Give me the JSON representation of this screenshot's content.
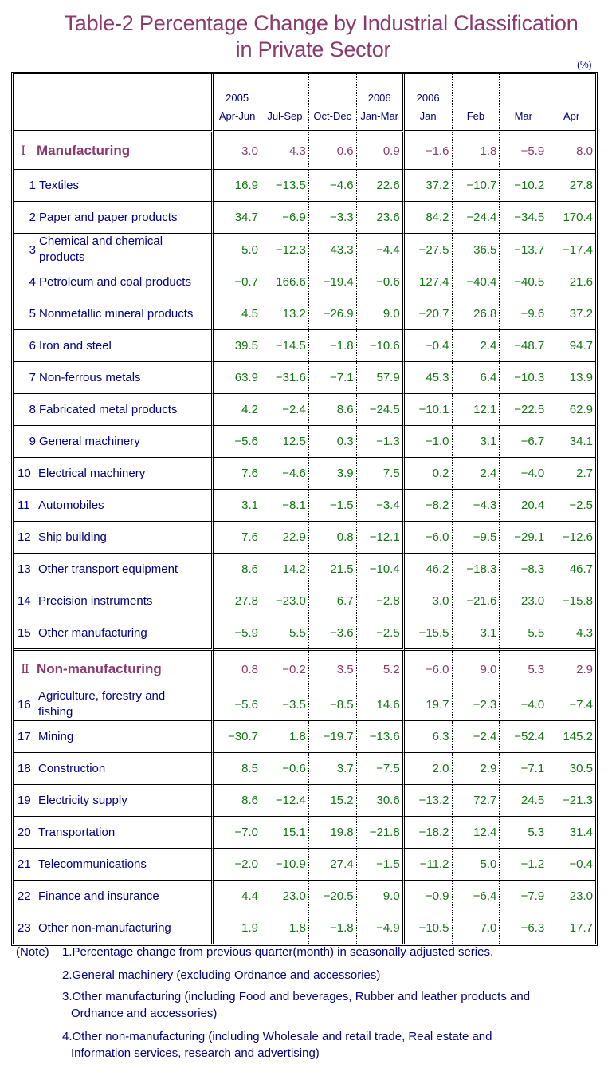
{
  "title": {
    "line1": "Table-2   Percentage Change by Industrial Classification",
    "line2": "in Private Sector"
  },
  "unit": "(%)",
  "headers": [
    {
      "year": "2005",
      "period": "Apr-Jun"
    },
    {
      "year": "",
      "period": "Jul-Sep"
    },
    {
      "year": "",
      "period": "Oct-Dec"
    },
    {
      "year": "2006",
      "period": "Jan-Mar"
    },
    {
      "year": "2006",
      "period": "Jan"
    },
    {
      "year": "",
      "period": "Feb"
    },
    {
      "year": "",
      "period": "Mar"
    },
    {
      "year": "",
      "period": "Apr"
    }
  ],
  "sections": [
    {
      "roman": "Ⅰ",
      "name": "Manufacturing",
      "values": [
        "3.0",
        "4.3",
        "0.6",
        "0.9",
        "−1.6",
        "1.8",
        "−5.9",
        "8.0"
      ],
      "items": [
        {
          "no": "1",
          "name": "Textiles",
          "values": [
            "16.9",
            "−13.5",
            "−4.6",
            "22.6",
            "37.2",
            "−10.7",
            "−10.2",
            "27.8"
          ]
        },
        {
          "no": "2",
          "name": "Paper and paper products",
          "values": [
            "34.7",
            "−6.9",
            "−3.3",
            "23.6",
            "84.2",
            "−24.4",
            "−34.5",
            "170.4"
          ]
        },
        {
          "no": "3",
          "name": "Chemical and chemical products",
          "values": [
            "5.0",
            "−12.3",
            "43.3",
            "−4.4",
            "−27.5",
            "36.5",
            "−13.7",
            "−17.4"
          ]
        },
        {
          "no": "4",
          "name": "Petroleum and coal products",
          "values": [
            "−0.7",
            "166.6",
            "−19.4",
            "−0.6",
            "127.4",
            "−40.4",
            "−40.5",
            "21.6"
          ]
        },
        {
          "no": "5",
          "name": "Nonmetallic mineral products",
          "values": [
            "4.5",
            "13.2",
            "−26.9",
            "9.0",
            "−20.7",
            "26.8",
            "−9.6",
            "37.2"
          ]
        },
        {
          "no": "6",
          "name": "Iron and steel",
          "values": [
            "39.5",
            "−14.5",
            "−1.8",
            "−10.6",
            "−0.4",
            "2.4",
            "−48.7",
            "94.7"
          ]
        },
        {
          "no": "7",
          "name": "Non-ferrous metals",
          "values": [
            "63.9",
            "−31.6",
            "−7.1",
            "57.9",
            "45.3",
            "6.4",
            "−10.3",
            "13.9"
          ]
        },
        {
          "no": "8",
          "name": "Fabricated metal products",
          "values": [
            "4.2",
            "−2.4",
            "8.6",
            "−24.5",
            "−10.1",
            "12.1",
            "−22.5",
            "62.9"
          ]
        },
        {
          "no": "9",
          "name": "General machinery",
          "values": [
            "−5.6",
            "12.5",
            "0.3",
            "−1.3",
            "−1.0",
            "3.1",
            "−6.7",
            "34.1"
          ]
        },
        {
          "no": "10",
          "name": "Electrical machinery",
          "values": [
            "7.6",
            "−4.6",
            "3.9",
            "7.5",
            "0.2",
            "2.4",
            "−4.0",
            "2.7"
          ]
        },
        {
          "no": "11",
          "name": "Automobiles",
          "values": [
            "3.1",
            "−8.1",
            "−1.5",
            "−3.4",
            "−8.2",
            "−4.3",
            "20.4",
            "−2.5"
          ]
        },
        {
          "no": "12",
          "name": "Ship building",
          "values": [
            "7.6",
            "22.9",
            "0.8",
            "−12.1",
            "−6.0",
            "−9.5",
            "−29.1",
            "−12.6"
          ]
        },
        {
          "no": "13",
          "name": "Other transport equipment",
          "values": [
            "8.6",
            "14.2",
            "21.5",
            "−10.4",
            "46.2",
            "−18.3",
            "−8.3",
            "46.7"
          ]
        },
        {
          "no": "14",
          "name": "Precision instruments",
          "values": [
            "27.8",
            "−23.0",
            "6.7",
            "−2.8",
            "3.0",
            "−21.6",
            "23.0",
            "−15.8"
          ]
        },
        {
          "no": "15",
          "name": "Other manufacturing",
          "values": [
            "−5.9",
            "5.5",
            "−3.6",
            "−2.5",
            "−15.5",
            "3.1",
            "5.5",
            "4.3"
          ]
        }
      ]
    },
    {
      "roman": "Ⅱ",
      "name": "Non-manufacturing",
      "values": [
        "0.8",
        "−0.2",
        "3.5",
        "5.2",
        "−6.0",
        "9.0",
        "5.3",
        "2.9"
      ],
      "items": [
        {
          "no": "16",
          "name": "Agriculture, forestry and fishing",
          "values": [
            "−5.6",
            "−3.5",
            "−8.5",
            "14.6",
            "19.7",
            "−2.3",
            "−4.0",
            "−7.4"
          ]
        },
        {
          "no": "17",
          "name": "Mining",
          "values": [
            "−30.7",
            "1.8",
            "−19.7",
            "−13.6",
            "6.3",
            "−2.4",
            "−52.4",
            "145.2"
          ]
        },
        {
          "no": "18",
          "name": "Construction",
          "values": [
            "8.5",
            "−0.6",
            "3.7",
            "−7.5",
            "2.0",
            "2.9",
            "−7.1",
            "30.5"
          ]
        },
        {
          "no": "19",
          "name": "Electricity supply",
          "values": [
            "8.6",
            "−12.4",
            "15.2",
            "30.6",
            "−13.2",
            "72.7",
            "24.5",
            "−21.3"
          ]
        },
        {
          "no": "20",
          "name": "Transportation",
          "values": [
            "−7.0",
            "15.1",
            "19.8",
            "−21.8",
            "−18.2",
            "12.4",
            "5.3",
            "31.4"
          ]
        },
        {
          "no": "21",
          "name": "Telecommunications",
          "values": [
            "−2.0",
            "−10.9",
            "27.4",
            "−1.5",
            "−11.2",
            "5.0",
            "−1.2",
            "−0.4"
          ]
        },
        {
          "no": "22",
          "name": "Finance and insurance",
          "values": [
            "4.4",
            "23.0",
            "−20.5",
            "9.0",
            "−0.9",
            "−6.4",
            "−7.9",
            "23.0"
          ]
        },
        {
          "no": "23",
          "name": "Other non-manufacturing",
          "values": [
            "1.9",
            "1.8",
            "−1.8",
            "−4.9",
            "−10.5",
            "7.0",
            "−6.3",
            "17.7"
          ]
        }
      ]
    }
  ],
  "notes": {
    "heading": "(Note)",
    "items": [
      {
        "text": "1.Percentage change from previous quarter(month) in seasonally adjusted series.",
        "cont": ""
      },
      {
        "text": "2.General machinery (excluding Ordnance and accessories)",
        "cont": ""
      },
      {
        "text": "3.Other manufacturing (including Food and beverages, Rubber and leather products and",
        "cont": "Ordnance and accessories)"
      },
      {
        "text": "4.Other non-manufacturing (including Wholesale and retail trade, Real estate and",
        "cont": "Information services, research and advertising)"
      }
    ]
  },
  "colors": {
    "title": "#8b3a6b",
    "label": "#000080",
    "value": "#117711",
    "section": "#8b3a6b"
  }
}
